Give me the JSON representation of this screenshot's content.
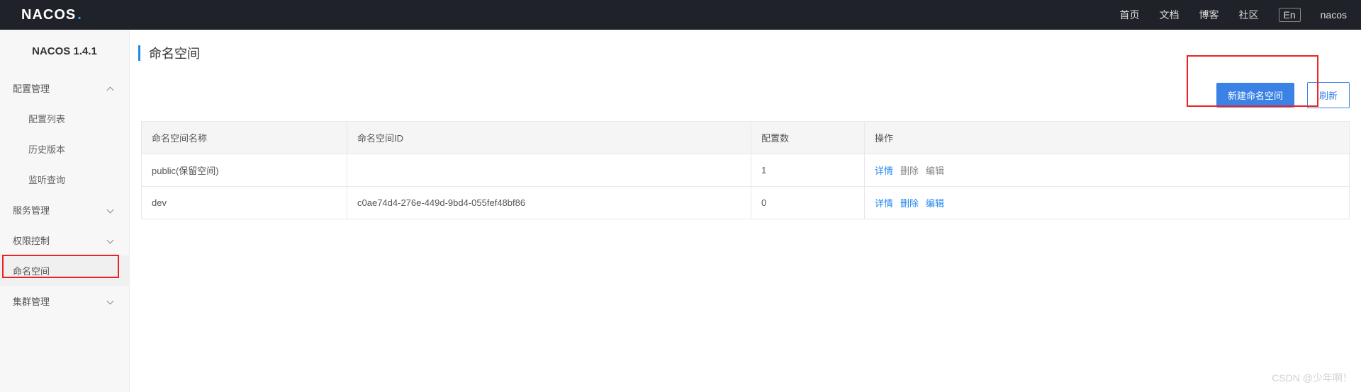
{
  "topbar": {
    "logo_text": "NACOS",
    "nav": {
      "home": "首页",
      "docs": "文档",
      "blog": "博客",
      "community": "社区"
    },
    "lang": "En",
    "user": "nacos"
  },
  "sidebar": {
    "version": "NACOS 1.4.1",
    "config_mgmt": "配置管理",
    "config_list": "配置列表",
    "history": "历史版本",
    "listen_query": "监听查询",
    "service_mgmt": "服务管理",
    "permission": "权限控制",
    "namespace": "命名空间",
    "cluster": "集群管理"
  },
  "page": {
    "title": "命名空间",
    "btn_new": "新建命名空间",
    "btn_refresh": "刷新"
  },
  "table": {
    "headers": {
      "name": "命名空间名称",
      "id": "命名空间ID",
      "count": "配置数",
      "ops": "操作"
    },
    "rows": [
      {
        "name": "public(保留空间)",
        "id": "",
        "count": "1",
        "detail": "详情",
        "delete": "删除",
        "edit": "编辑",
        "disabled": true
      },
      {
        "name": "dev",
        "id": "c0ae74d4-276e-449d-9bd4-055fef48bf86",
        "count": "0",
        "detail": "详情",
        "delete": "删除",
        "edit": "编辑",
        "disabled": false
      }
    ]
  },
  "watermark": "CSDN @少年啊！"
}
